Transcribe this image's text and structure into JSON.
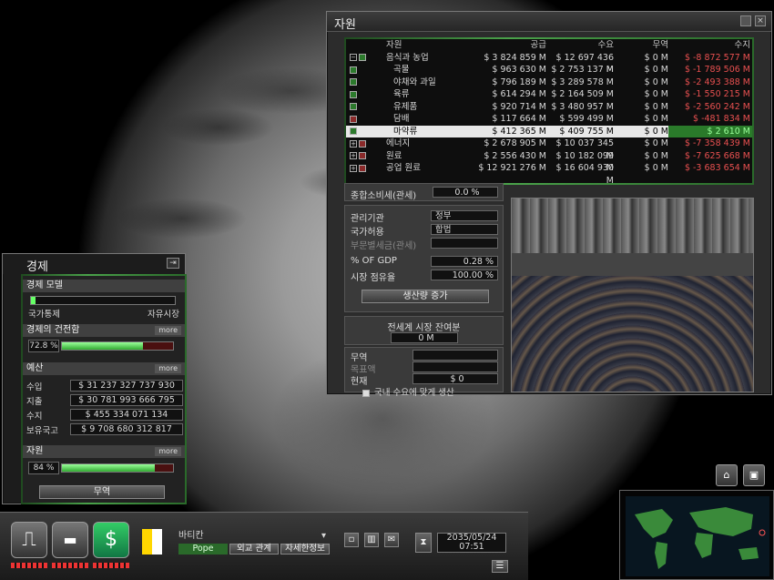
{
  "resources": {
    "title": "자원",
    "headers": [
      "자원",
      "공급",
      "수요",
      "무역",
      "수지"
    ],
    "rows": [
      {
        "toggle": "−",
        "name": "음식과 농업",
        "supply": "$ 3 824 859 M",
        "demand": "$ 12 697 436 M",
        "trade": "$ 0 M",
        "balance": "$ -8 872 577 M",
        "status": "neg",
        "sub": false,
        "selected": false,
        "indicator": "g"
      },
      {
        "toggle": "",
        "name": "곡물",
        "supply": "$ 963 630 M",
        "demand": "$ 2 753 137 M",
        "trade": "$ 0 M",
        "balance": "$ -1 789 506 M",
        "status": "neg",
        "sub": true,
        "selected": false,
        "indicator": "g"
      },
      {
        "toggle": "",
        "name": "야채와 과일",
        "supply": "$ 796 189 M",
        "demand": "$ 3 289 578 M",
        "trade": "$ 0 M",
        "balance": "$ -2 493 388 M",
        "status": "neg",
        "sub": true,
        "selected": false,
        "indicator": "g"
      },
      {
        "toggle": "",
        "name": "육류",
        "supply": "$ 614 294 M",
        "demand": "$ 2 164 509 M",
        "trade": "$ 0 M",
        "balance": "$ -1 550 215 M",
        "status": "neg",
        "sub": true,
        "selected": false,
        "indicator": "g"
      },
      {
        "toggle": "",
        "name": "유제품",
        "supply": "$ 920 714 M",
        "demand": "$ 3 480 957 M",
        "trade": "$ 0 M",
        "balance": "$ -2 560 242 M",
        "status": "neg",
        "sub": true,
        "selected": false,
        "indicator": "g"
      },
      {
        "toggle": "",
        "name": "담배",
        "supply": "$ 117 664 M",
        "demand": "$ 599 499 M",
        "trade": "$ 0 M",
        "balance": "$ -481 834 M",
        "status": "neg",
        "sub": true,
        "selected": false,
        "indicator": "r"
      },
      {
        "toggle": "",
        "name": "마약류",
        "supply": "$ 412 365 M",
        "demand": "$ 409 755 M",
        "trade": "$ 0 M",
        "balance": "$ 2 610 M",
        "status": "pos",
        "sub": true,
        "selected": true,
        "indicator": "g"
      },
      {
        "toggle": "+",
        "name": "에너지",
        "supply": "$ 2 678 905 M",
        "demand": "$ 10 037 345 M",
        "trade": "$ 0 M",
        "balance": "$ -7 358 439 M",
        "status": "neg",
        "sub": false,
        "selected": false,
        "indicator": "r"
      },
      {
        "toggle": "+",
        "name": "원료",
        "supply": "$ 2 556 430 M",
        "demand": "$ 10 182 099 M",
        "trade": "$ 0 M",
        "balance": "$ -7 625 668 M",
        "status": "neg",
        "sub": false,
        "selected": false,
        "indicator": "r"
      },
      {
        "toggle": "+",
        "name": "공업 원료",
        "supply": "$ 12 921 276 M",
        "demand": "$ 16 604 930 M",
        "trade": "$ 0 M",
        "balance": "$ -3 683 654 M",
        "status": "neg",
        "sub": false,
        "selected": false,
        "indicator": "r"
      }
    ],
    "tax_label": "종합소비세(관세)",
    "tax_value": "0.0 %",
    "agency_label": "관리기관",
    "agency_value": "정부",
    "legality_label": "국가허용",
    "legality_value": "합법",
    "sector_tax_label": "부문별세금(관세)",
    "gdp_label": "% OF GDP",
    "gdp_value": "0.28 %",
    "share_label": "시장 점유율",
    "share_value": "100.00 %",
    "increase_btn": "생산량 증가",
    "world_surplus_label": "전세계 시장 잔여분",
    "world_surplus_value": "0 M",
    "trade_label": "무역",
    "target_label": "목표액",
    "current_label": "현재",
    "current_value": "$ 0",
    "domestic_label": "국내 수요에 맞게 생산"
  },
  "economy": {
    "title": "경제",
    "model_label": "경제 모델",
    "left_label": "국가통제",
    "right_label": "자유시장",
    "health_label": "경제의 건전함",
    "health_value": "72.8 %",
    "health_level": 0.728,
    "more": "more",
    "budget_label": "예산",
    "income_label": "수입",
    "income_value": "$ 31 237 327 737 930",
    "expense_label": "지출",
    "expense_value": "$ 30 781 993 666 795",
    "balance_label": "수지",
    "balance_value": "$ 455 334 071 134",
    "reserve_label": "보유국고",
    "reserve_value": "$ 9 708 680 312 817",
    "resources_label": "자원",
    "resources_value": "84 %",
    "resources_level": 0.84,
    "trade_btn": "무역"
  },
  "bottom": {
    "country": "바티칸",
    "leader": "Pope",
    "diplomacy": "외교 관계",
    "details": "자세한정보",
    "date": "2035/05/24",
    "time": "07:51"
  },
  "colors": {
    "accent_green": "#4aa24a",
    "negative": "#e85050",
    "positive": "#50e050"
  }
}
